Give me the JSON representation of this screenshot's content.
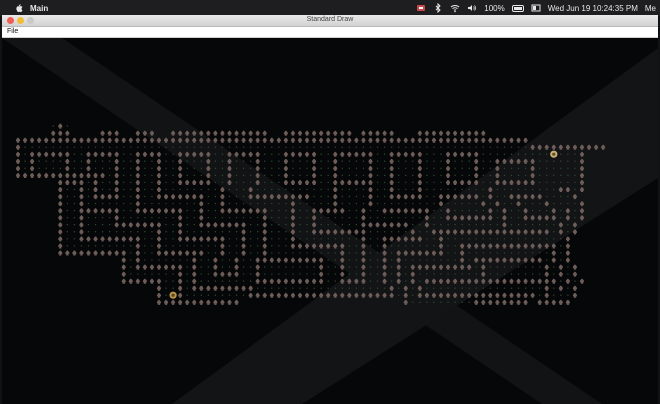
{
  "menubar": {
    "app_name": "Main",
    "battery_text": "100%",
    "datetime": "Wed Jun 19  10:24:35 PM",
    "trailing_text": "Me"
  },
  "window": {
    "title": "Standard Draw",
    "menu_file": "File"
  },
  "game": {
    "wall_color": "#6e5d58",
    "floor_color": "#2f4a34",
    "background_color": "#060708",
    "player_icon": "avatar-icon",
    "goal_icon": "gold-coin-icon",
    "grid_rows": [
      "     .W.                                                                               ",
      "     WWW    WWW  WWW  WWWWWWWWWWWWWW  WWWWWWWWWW WWWWW   WWWWWWWWWW                    ",
      "WWWWWWWWWWWWWWWWWWWWWWWWWWWWWWWWWWWWWWWWWWWWWWWWWWWWWWWWWWWWWWWWWWWWWWWWW               ",
      "W........................................................................WWWWWWWWWWW",
      "W.WWWWWW..WWWWW..WWWW..WWWWW..WWWWW...WWWWW..WWWWWW..WWWWW...WWWWW..........G...W",
      "W.W....W..W...W..W..W..W...W..W...W...W...W..W....W..W...W...W...W..WWWWWW......W",
      "W.W....W..W...W..W..W..W...W..W...W...W...W..W....W..W...W...W...W..W....W......W",
      "WWWWWWWWWWWWW.W..W..W..W...W..W...W...W...W..W....W..W...W...W...W..W....W......W",
      "      WWWW.W..W..W..W..WWWWW..W...W...WWWWW..WWWWWW..W...W...WWWWW..WWWWWW......W",
      "      W..W.W..W..W..W........W...W...........W....W..W...W.........W.........WW.W",
      "      W..W.WWWW..W..WWWWWWW..W...WWWWWWWWW...W....W..WWWWW..WWWWWW.W..WWWWW....W",
      "      W..W.......W........W..W.........W.....W....W.........W.....W.W..W...W....W",
      "      W..WWWWWW..WWWWWWW..W..WWWWWWW...W..WWWWW..W..WWWWWWW..W.....W.W..W...W.W.W",
      "      W..W....W........W..W........W...W..W......W........W..WWWWWWW.W..WWWWW.W.W",
      "      W..W....WWWWWWW..W..WWWWWWW..W...W..W......WWWWWWW..W..........W.......W.W",
      "      W..W..........W..W........W..W...W..WWWWWWWW......W..WWWWWWWWWWWWWWWWW.W.W",
      "      W..WWWWWWWWW..W..WWWWWWW..W..W...W.........W..WWWWWW..W.................W",
      "      W..........W..W........W..W..W...WWWWWWWW..W..W.......W..WWWWWWWWWWWWWW.W",
      "      WWWWWWWWWW.W..WWWWWWW..W..W..W..........W..W..W.WWWWWWW..W............W.W",
      "               W.W.......W..W..W..WWWWWWWWWW..W..W..W.W........W.WWWWWWWWWW.W.W",
      "               W.WWWWWWW.W..W..W..W........W..W..W..W.W.WWWWWWWWW.W........W.W.W",
      "               W.......W.W..WWWW..W........W..W..W..W.W.W.........W........W.W.W",
      "               WWWWWW..W.W........WWWWWWWWWW..WWWW..W.W.W.WWWWWWWWWWWWWWWWWWW.W.W",
      "                    W..W.WWWWWWWWW...................W.W.W.................W.W.W",
      "                    W.PW.........WWWWWWWWWWWWWWWWWWWWW.W.WWWWWWWWWWWWWWWWW.W...W",
      "                    WWWWWWWWWWWW                       W.........WWWWWWWW WWWWW"
    ]
  }
}
